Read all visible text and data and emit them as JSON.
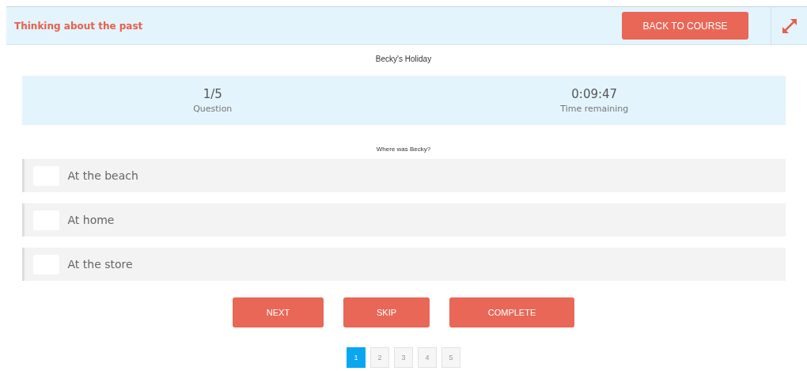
{
  "header": {
    "title": "Thinking about the past",
    "back_button": "BACK TO COURSE"
  },
  "quiz_title": "Becky's Holiday",
  "stats": [
    {
      "value": "1/5",
      "label": "Question"
    },
    {
      "value": "0:09:47",
      "label": "Time remaining"
    }
  ],
  "question": "Where was Becky?",
  "options": [
    {
      "label": "At the beach",
      "checked": false
    },
    {
      "label": "At home",
      "checked": false
    },
    {
      "label": "At the store",
      "checked": false
    }
  ],
  "buttons": [
    "NEXT",
    "SKIP",
    "COMPLETE"
  ],
  "pages": [
    {
      "label": "1",
      "selected": true
    },
    {
      "label": "2",
      "selected": false
    },
    {
      "label": "3",
      "selected": false
    },
    {
      "label": "4",
      "selected": false
    },
    {
      "label": "5",
      "selected": false
    }
  ]
}
